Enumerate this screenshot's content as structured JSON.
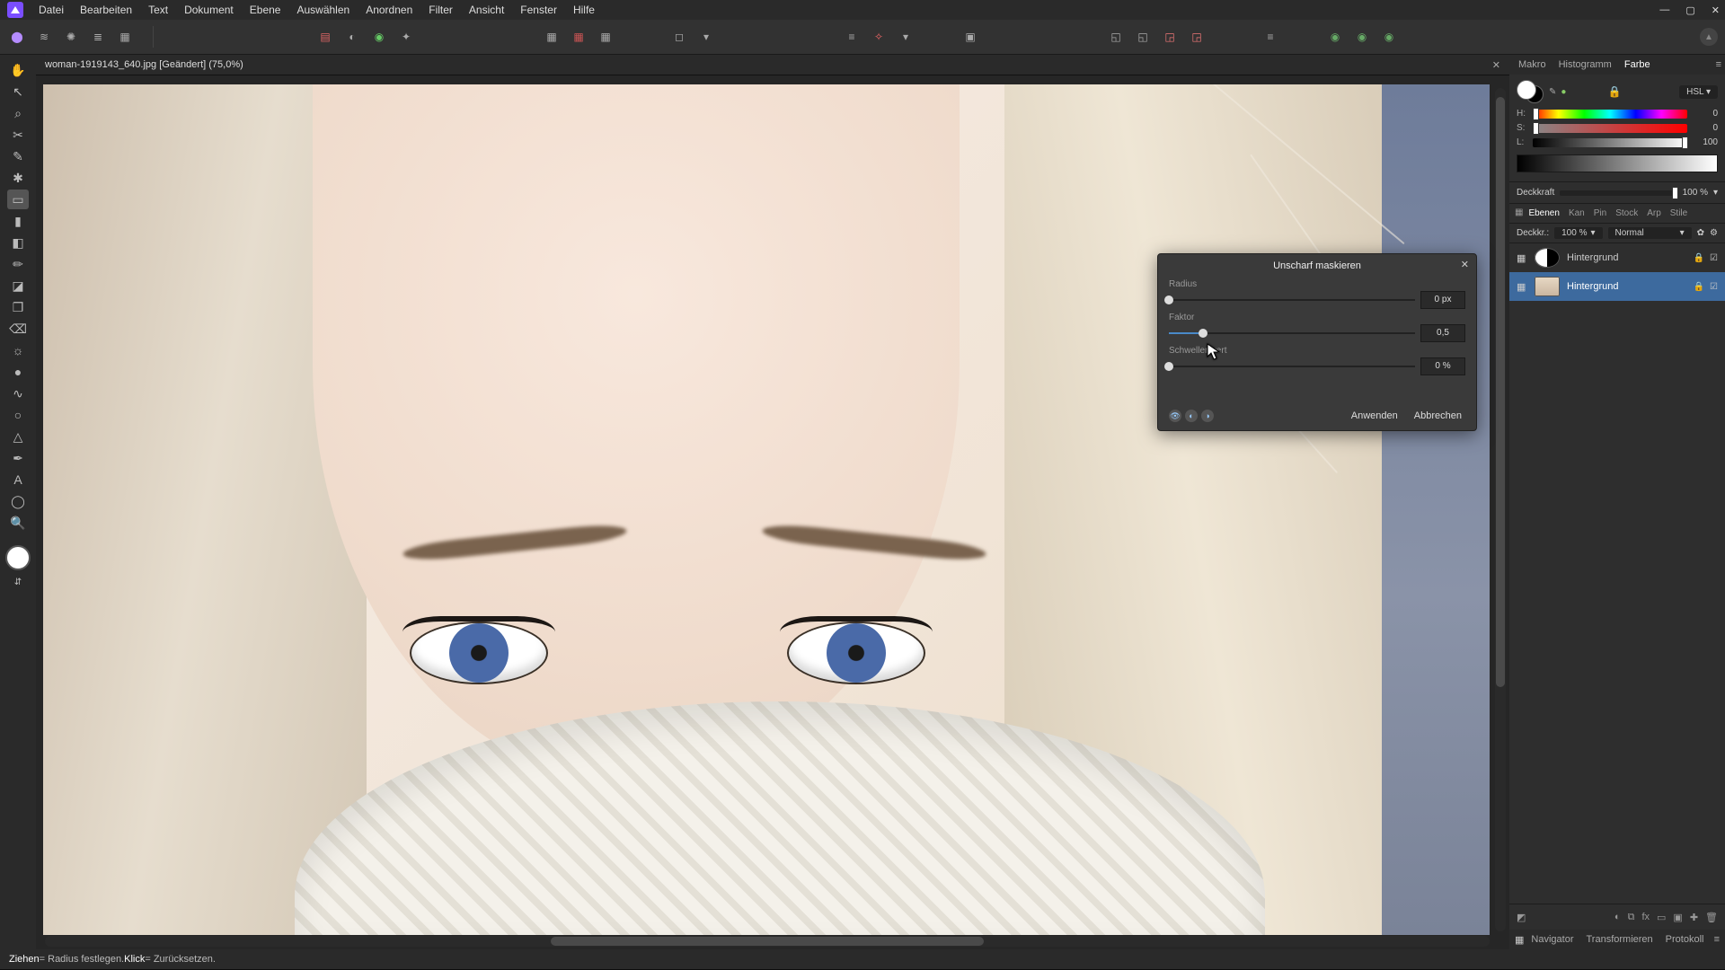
{
  "menu": [
    "Datei",
    "Bearbeiten",
    "Text",
    "Dokument",
    "Ebene",
    "Auswählen",
    "Anordnen",
    "Filter",
    "Ansicht",
    "Fenster",
    "Hilfe"
  ],
  "document": {
    "tab_title": "woman-1919143_640.jpg [Geändert] (75,0%)"
  },
  "dialog": {
    "title": "Unscharf maskieren",
    "radius_label": "Radius",
    "radius_value": "0 px",
    "radius_pct": 0,
    "factor_label": "Faktor",
    "factor_value": "0,5",
    "factor_pct": 14,
    "threshold_label": "Schwellenwert",
    "threshold_value": "0 %",
    "threshold_pct": 0,
    "apply": "Anwenden",
    "cancel": "Abbrechen"
  },
  "color_panel": {
    "tabs": [
      "Makro",
      "Histogramm",
      "Farbe"
    ],
    "mode": "HSL",
    "h": {
      "label": "H:",
      "value": "0",
      "thumb": 0
    },
    "s": {
      "label": "S:",
      "value": "0",
      "thumb": 0
    },
    "l": {
      "label": "L:",
      "value": "100",
      "thumb": 100
    }
  },
  "opacity": {
    "label": "Deckkraft",
    "value": "100 %"
  },
  "layer_tabs": [
    "Ebenen",
    "Kan",
    "Pin",
    "Stock",
    "Arp",
    "Stile"
  ],
  "layer_ctrl": {
    "opacity_label": "Deckkr.:",
    "opacity_value": "100 %",
    "blend": "Normal"
  },
  "layers": [
    {
      "name": "Hintergrund",
      "type": "adjust",
      "selected": false
    },
    {
      "name": "Hintergrund",
      "type": "image",
      "selected": true
    }
  ],
  "bottom_tabs": [
    "Navigator",
    "Transformieren",
    "Protokoll"
  ],
  "status": {
    "drag": "Ziehen",
    "drag_desc": " = Radius festlegen. ",
    "click": "Klick",
    "click_desc": " = Zurücksetzen."
  }
}
